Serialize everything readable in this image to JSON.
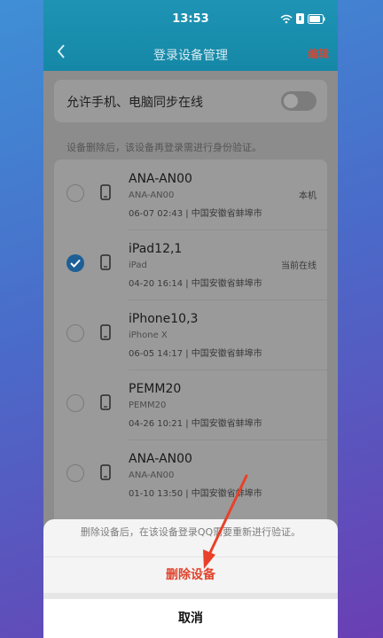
{
  "status": {
    "time": "13:53"
  },
  "nav": {
    "title": "登录设备管理",
    "action": "编辑"
  },
  "sync": {
    "label": "允许手机、电脑同步在线",
    "enabled": false
  },
  "hint": "设备删除后，该设备再登录需进行身份验证。",
  "devices": [
    {
      "name": "ANA-AN00",
      "model": "ANA-AN00",
      "meta": "06-07 02:43 | 中国安徽省蚌埠市",
      "badge": "本机",
      "checked": false
    },
    {
      "name": "iPad12,1",
      "model": "iPad",
      "meta": "04-20 16:14 | 中国安徽省蚌埠市",
      "badge": "当前在线",
      "checked": true
    },
    {
      "name": "iPhone10,3",
      "model": "iPhone X",
      "meta": "06-05 14:17 | 中国安徽省蚌埠市",
      "badge": "",
      "checked": false
    },
    {
      "name": "PEMM20",
      "model": "PEMM20",
      "meta": "04-26 10:21 | 中国安徽省蚌埠市",
      "badge": "",
      "checked": false
    },
    {
      "name": "ANA-AN00",
      "model": "ANA-AN00",
      "meta": "01-10 13:50 | 中国安徽省蚌埠市",
      "badge": "",
      "checked": false
    }
  ],
  "sheet": {
    "message": "删除设备后，在该设备登录QQ需要重新进行验证。",
    "delete_label": "删除设备",
    "cancel_label": "取消"
  },
  "colors": {
    "accent": "#1f93b4",
    "danger": "#e0452e",
    "annotation": "#e8412a"
  }
}
